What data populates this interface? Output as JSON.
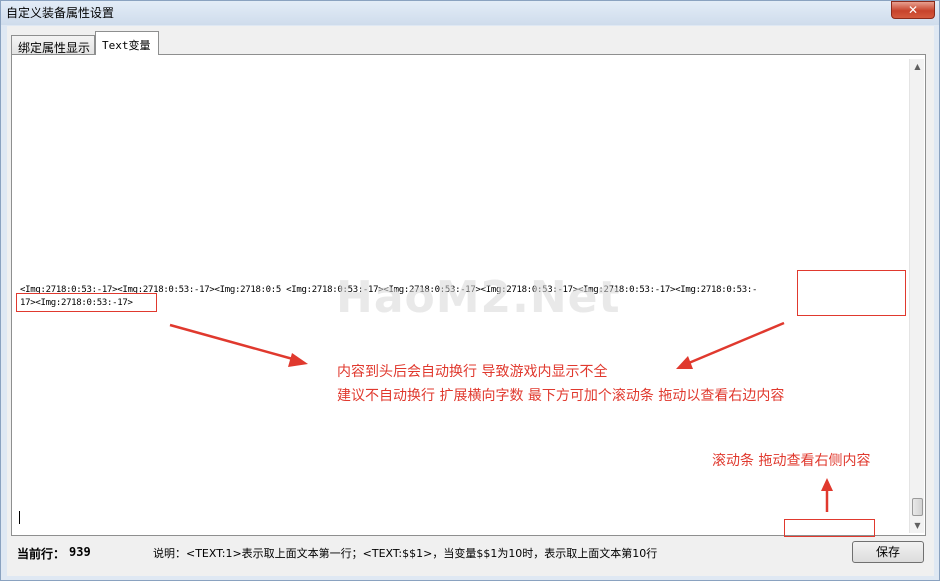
{
  "window": {
    "title": "自定义装备属性设置",
    "close_label": "✕"
  },
  "tabs": [
    {
      "label": "绑定属性显示"
    },
    {
      "label": "Text变量"
    }
  ],
  "editor": {
    "line1": "<Img:2718:0:53:-17><Img:2718:0:53:-17><Img:2718:0:5    <Img:2718:0:53:-17><Img:2718:0:53:-17><Img:2718:0:53:-17><Img:2718:0:53:-17><Img:2718:0:53:-",
    "line2": "17><Img:2718:0:53:-17>"
  },
  "watermark": "HaoM2.Net",
  "annotations": {
    "note1": "内容到头后会自动换行 导致游戏内显示不全",
    "note2": "建议不自动换行 扩展横向字数  最下方可加个滚动条 拖动以查看右边内容",
    "note3": "滚动条 拖动查看右侧内容"
  },
  "status": {
    "current_line_label": "当前行：",
    "current_line_value": "939",
    "description": "说明：<TEXT:1>表示取上面文本第一行；<TEXT:$$1>，当变量$$1为10时，表示取上面文本第10行"
  },
  "buttons": {
    "save": "保存"
  },
  "colors": {
    "annotation": "#e0392e",
    "title_bar": "#cfdcec"
  }
}
